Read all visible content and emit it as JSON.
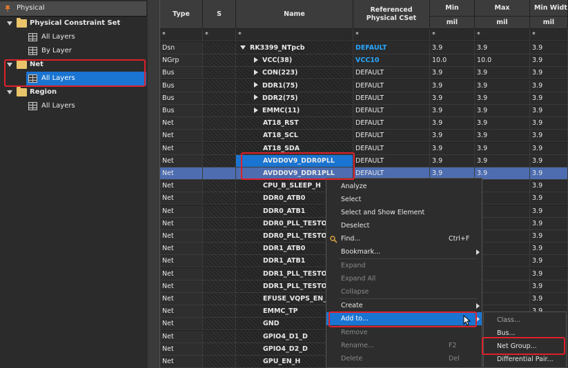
{
  "tree": {
    "title": "Physical",
    "items": [
      {
        "label": "Physical Constraint Set",
        "kind": "folder"
      },
      {
        "label": "All Layers",
        "kind": "table"
      },
      {
        "label": "By Layer",
        "kind": "table"
      },
      {
        "label": "Net",
        "kind": "folder"
      },
      {
        "label": "All Layers",
        "kind": "table"
      },
      {
        "label": "Region",
        "kind": "folder"
      },
      {
        "label": "All Layers",
        "kind": "table"
      }
    ]
  },
  "grid": {
    "headers": {
      "type": "Type",
      "s": "S",
      "name": "Name",
      "ref": "Referenced Physical CSet",
      "min": "Min",
      "max": "Max",
      "minwidth": "Min Widt",
      "unit_min": "mil",
      "unit_max": "mil",
      "unit_mw": "mil"
    },
    "filter": "*",
    "rows": [
      {
        "type": "Dsn",
        "name": "RK3399_NTpcb",
        "ref": "DEFAULT",
        "min": "3.9",
        "max": "3.9",
        "mw": "3.9"
      },
      {
        "type": "NGrp",
        "name": "VCC(38)",
        "ref": "VCC10",
        "min": "10.0",
        "max": "10.0",
        "mw": "3.9"
      },
      {
        "type": "Bus",
        "name": "CON(223)",
        "ref": "DEFAULT",
        "min": "3.9",
        "max": "3.9",
        "mw": "3.9"
      },
      {
        "type": "Bus",
        "name": "DDR1(75)",
        "ref": "DEFAULT",
        "min": "3.9",
        "max": "3.9",
        "mw": "3.9"
      },
      {
        "type": "Bus",
        "name": "DDR2(75)",
        "ref": "DEFAULT",
        "min": "3.9",
        "max": "3.9",
        "mw": "3.9"
      },
      {
        "type": "Bus",
        "name": "EMMC(11)",
        "ref": "DEFAULT",
        "min": "3.9",
        "max": "3.9",
        "mw": "3.9"
      },
      {
        "type": "Net",
        "name": "AT18_RST",
        "ref": "DEFAULT",
        "min": "3.9",
        "max": "3.9",
        "mw": "3.9"
      },
      {
        "type": "Net",
        "name": "AT18_SCL",
        "ref": "DEFAULT",
        "min": "3.9",
        "max": "3.9",
        "mw": "3.9"
      },
      {
        "type": "Net",
        "name": "AT18_SDA",
        "ref": "DEFAULT",
        "min": "3.9",
        "max": "3.9",
        "mw": "3.9"
      },
      {
        "type": "Net",
        "name": "AVDD0V9_DDR0PLL",
        "ref": "DEFAULT",
        "min": "3.9",
        "max": "3.9",
        "mw": "3.9"
      },
      {
        "type": "Net",
        "name": "AVDD0V9_DDR1PLL",
        "ref": "DEFAULT",
        "min": "3.9",
        "max": "3.9",
        "mw": "3.9"
      },
      {
        "type": "Net",
        "name": "CPU_B_SLEEP_H",
        "ref": "",
        "min": "",
        "max": "",
        "mw": "3.9"
      },
      {
        "type": "Net",
        "name": "DDR0_ATB0",
        "ref": "",
        "min": "",
        "max": "",
        "mw": "3.9"
      },
      {
        "type": "Net",
        "name": "DDR0_ATB1",
        "ref": "",
        "min": "",
        "max": "",
        "mw": "3.9"
      },
      {
        "type": "Net",
        "name": "DDR0_PLL_TESTOUT",
        "ref": "",
        "min": "",
        "max": "",
        "mw": "3.9"
      },
      {
        "type": "Net",
        "name": "DDR0_PLL_TESTOUT",
        "ref": "",
        "min": "",
        "max": "",
        "mw": "3.9"
      },
      {
        "type": "Net",
        "name": "DDR1_ATB0",
        "ref": "",
        "min": "",
        "max": "",
        "mw": "3.9"
      },
      {
        "type": "Net",
        "name": "DDR1_ATB1",
        "ref": "",
        "min": "",
        "max": "",
        "mw": "3.9"
      },
      {
        "type": "Net",
        "name": "DDR1_PLL_TESTOUT",
        "ref": "",
        "min": "",
        "max": "",
        "mw": "3.9"
      },
      {
        "type": "Net",
        "name": "DDR1_PLL_TESTOUT",
        "ref": "",
        "min": "",
        "max": "",
        "mw": "3.9"
      },
      {
        "type": "Net",
        "name": "EFUSE_VQPS_EN_H",
        "ref": "",
        "min": "",
        "max": "",
        "mw": "3.9"
      },
      {
        "type": "Net",
        "name": "EMMC_TP",
        "ref": "",
        "min": "",
        "max": "",
        "mw": "3.9"
      },
      {
        "type": "Net",
        "name": "GND",
        "ref": "",
        "min": "",
        "max": "",
        "mw": "3.9"
      },
      {
        "type": "Net",
        "name": "GPIO4_D1_D",
        "ref": "",
        "min": "",
        "max": "",
        "mw": "3.9"
      },
      {
        "type": "Net",
        "name": "GPIO4_D2_D",
        "ref": "",
        "min": "",
        "max": "",
        "mw": "3.9"
      },
      {
        "type": "Net",
        "name": "GPU_EN_H",
        "ref": "",
        "min": "",
        "max": "",
        "mw": ""
      }
    ]
  },
  "context_menu": {
    "items": [
      {
        "label": "Analyze",
        "shortcut": "",
        "state": "normal"
      },
      {
        "label": "Select",
        "shortcut": "",
        "state": "normal"
      },
      {
        "label": "Select and Show Element",
        "shortcut": "",
        "state": "normal"
      },
      {
        "label": "Deselect",
        "shortcut": "",
        "state": "normal"
      },
      {
        "label": "Find...",
        "shortcut": "Ctrl+F",
        "state": "normal"
      },
      {
        "label": "Bookmark...",
        "shortcut": "",
        "state": "submenu"
      },
      {
        "label": "Expand",
        "shortcut": "",
        "state": "disabled"
      },
      {
        "label": "Expand All",
        "shortcut": "",
        "state": "disabled"
      },
      {
        "label": "Collapse",
        "shortcut": "",
        "state": "disabled"
      },
      {
        "label": "Create",
        "shortcut": "",
        "state": "submenu"
      },
      {
        "label": "Add to...",
        "shortcut": "",
        "state": "active"
      },
      {
        "label": "Remove",
        "shortcut": "",
        "state": "disabled"
      },
      {
        "label": "Rename...",
        "shortcut": "F2",
        "state": "disabled"
      },
      {
        "label": "Delete",
        "shortcut": "Del",
        "state": "disabled"
      }
    ]
  },
  "submenu": {
    "items": [
      {
        "label": "Class...",
        "state": "disabled"
      },
      {
        "label": "Bus...",
        "state": "normal"
      },
      {
        "label": "Net Group...",
        "state": "normal"
      },
      {
        "label": "Differential Pair...",
        "state": "normal"
      }
    ]
  },
  "colors": {
    "selection": "#1a74d1",
    "highlight_row": "#4d6db0",
    "link_blue": "#27a7ff",
    "annotation_red": "#e0202b"
  }
}
